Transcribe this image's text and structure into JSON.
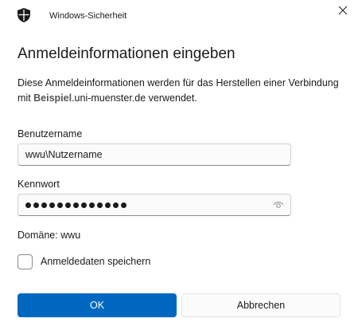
{
  "window": {
    "title": "Windows-Sicherheit",
    "icons": {
      "app": "shield-icon",
      "close": "close-icon"
    }
  },
  "dialog": {
    "heading": "Anmeldeinformationen eingeben",
    "description_prefix": "Diese Anmeldeinformationen werden für das Herstellen einer Verbindung mit ",
    "description_host_bold": "Beispiel",
    "description_suffix": ".uni-muenster.de verwendet."
  },
  "username": {
    "label": "Benutzername",
    "value": "wwu\\Nutzername"
  },
  "password": {
    "label": "Kennwort",
    "masked_length": 13,
    "reveal_icon": "eye-icon"
  },
  "domain_text": "Domäne: wwu",
  "remember": {
    "label": "Anmeldedaten speichern",
    "checked": false
  },
  "buttons": {
    "ok": "OK",
    "cancel": "Abbrechen"
  },
  "colors": {
    "accent": "#0067c0"
  }
}
